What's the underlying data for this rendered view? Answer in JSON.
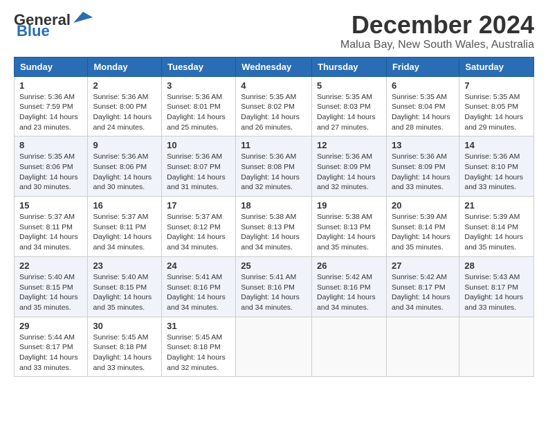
{
  "logo": {
    "line1": "General",
    "line2": "Blue",
    "arrow_color": "#2a6db5"
  },
  "title": "December 2024",
  "location": "Malua Bay, New South Wales, Australia",
  "days_header": [
    "Sunday",
    "Monday",
    "Tuesday",
    "Wednesday",
    "Thursday",
    "Friday",
    "Saturday"
  ],
  "weeks": [
    [
      {
        "day": "1",
        "sunrise": "5:36 AM",
        "sunset": "7:59 PM",
        "daylight": "14 hours and 23 minutes."
      },
      {
        "day": "2",
        "sunrise": "5:36 AM",
        "sunset": "8:00 PM",
        "daylight": "14 hours and 24 minutes."
      },
      {
        "day": "3",
        "sunrise": "5:36 AM",
        "sunset": "8:01 PM",
        "daylight": "14 hours and 25 minutes."
      },
      {
        "day": "4",
        "sunrise": "5:35 AM",
        "sunset": "8:02 PM",
        "daylight": "14 hours and 26 minutes."
      },
      {
        "day": "5",
        "sunrise": "5:35 AM",
        "sunset": "8:03 PM",
        "daylight": "14 hours and 27 minutes."
      },
      {
        "day": "6",
        "sunrise": "5:35 AM",
        "sunset": "8:04 PM",
        "daylight": "14 hours and 28 minutes."
      },
      {
        "day": "7",
        "sunrise": "5:35 AM",
        "sunset": "8:05 PM",
        "daylight": "14 hours and 29 minutes."
      }
    ],
    [
      {
        "day": "8",
        "sunrise": "5:35 AM",
        "sunset": "8:06 PM",
        "daylight": "14 hours and 30 minutes."
      },
      {
        "day": "9",
        "sunrise": "5:36 AM",
        "sunset": "8:06 PM",
        "daylight": "14 hours and 30 minutes."
      },
      {
        "day": "10",
        "sunrise": "5:36 AM",
        "sunset": "8:07 PM",
        "daylight": "14 hours and 31 minutes."
      },
      {
        "day": "11",
        "sunrise": "5:36 AM",
        "sunset": "8:08 PM",
        "daylight": "14 hours and 32 minutes."
      },
      {
        "day": "12",
        "sunrise": "5:36 AM",
        "sunset": "8:09 PM",
        "daylight": "14 hours and 32 minutes."
      },
      {
        "day": "13",
        "sunrise": "5:36 AM",
        "sunset": "8:09 PM",
        "daylight": "14 hours and 33 minutes."
      },
      {
        "day": "14",
        "sunrise": "5:36 AM",
        "sunset": "8:10 PM",
        "daylight": "14 hours and 33 minutes."
      }
    ],
    [
      {
        "day": "15",
        "sunrise": "5:37 AM",
        "sunset": "8:11 PM",
        "daylight": "14 hours and 34 minutes."
      },
      {
        "day": "16",
        "sunrise": "5:37 AM",
        "sunset": "8:11 PM",
        "daylight": "14 hours and 34 minutes."
      },
      {
        "day": "17",
        "sunrise": "5:37 AM",
        "sunset": "8:12 PM",
        "daylight": "14 hours and 34 minutes."
      },
      {
        "day": "18",
        "sunrise": "5:38 AM",
        "sunset": "8:13 PM",
        "daylight": "14 hours and 34 minutes."
      },
      {
        "day": "19",
        "sunrise": "5:38 AM",
        "sunset": "8:13 PM",
        "daylight": "14 hours and 35 minutes."
      },
      {
        "day": "20",
        "sunrise": "5:39 AM",
        "sunset": "8:14 PM",
        "daylight": "14 hours and 35 minutes."
      },
      {
        "day": "21",
        "sunrise": "5:39 AM",
        "sunset": "8:14 PM",
        "daylight": "14 hours and 35 minutes."
      }
    ],
    [
      {
        "day": "22",
        "sunrise": "5:40 AM",
        "sunset": "8:15 PM",
        "daylight": "14 hours and 35 minutes."
      },
      {
        "day": "23",
        "sunrise": "5:40 AM",
        "sunset": "8:15 PM",
        "daylight": "14 hours and 35 minutes."
      },
      {
        "day": "24",
        "sunrise": "5:41 AM",
        "sunset": "8:16 PM",
        "daylight": "14 hours and 34 minutes."
      },
      {
        "day": "25",
        "sunrise": "5:41 AM",
        "sunset": "8:16 PM",
        "daylight": "14 hours and 34 minutes."
      },
      {
        "day": "26",
        "sunrise": "5:42 AM",
        "sunset": "8:16 PM",
        "daylight": "14 hours and 34 minutes."
      },
      {
        "day": "27",
        "sunrise": "5:42 AM",
        "sunset": "8:17 PM",
        "daylight": "14 hours and 34 minutes."
      },
      {
        "day": "28",
        "sunrise": "5:43 AM",
        "sunset": "8:17 PM",
        "daylight": "14 hours and 33 minutes."
      }
    ],
    [
      {
        "day": "29",
        "sunrise": "5:44 AM",
        "sunset": "8:17 PM",
        "daylight": "14 hours and 33 minutes."
      },
      {
        "day": "30",
        "sunrise": "5:45 AM",
        "sunset": "8:18 PM",
        "daylight": "14 hours and 33 minutes."
      },
      {
        "day": "31",
        "sunrise": "5:45 AM",
        "sunset": "8:18 PM",
        "daylight": "14 hours and 32 minutes."
      },
      null,
      null,
      null,
      null
    ]
  ]
}
